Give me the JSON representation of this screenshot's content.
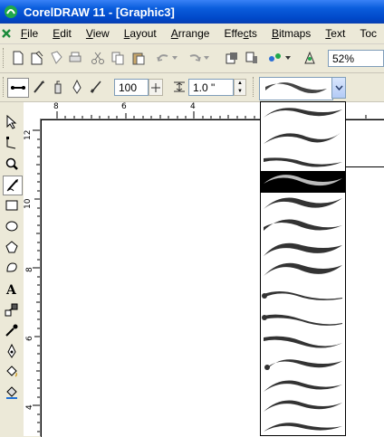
{
  "window": {
    "title": "CorelDRAW 11 - [Graphic3]"
  },
  "menu": [
    {
      "label": "File",
      "key": "F",
      "rest": "ile"
    },
    {
      "label": "Edit",
      "key": "E",
      "rest": "dit"
    },
    {
      "label": "View",
      "key": "V",
      "rest": "iew"
    },
    {
      "label": "Layout",
      "key": "L",
      "rest": "ayout"
    },
    {
      "label": "Arrange",
      "key": "A",
      "rest": "rrange"
    },
    {
      "label": "Effects",
      "key": "C",
      "pre": "Effe",
      "rest": "ts"
    },
    {
      "label": "Bitmaps",
      "key": "B",
      "rest": "itmaps"
    },
    {
      "label": "Text",
      "key": "T",
      "rest": "ext"
    },
    {
      "label": "Toc",
      "key": "",
      "rest": "Toc"
    }
  ],
  "standard_toolbar": {
    "zoom_value": "52%"
  },
  "property_bar": {
    "smoothing_value": "100",
    "width_value": "1.0 \""
  },
  "rulers": {
    "top_ticks": [
      "8",
      "6",
      "4"
    ],
    "left_ticks": [
      "12",
      "10",
      "8",
      "6",
      "4"
    ]
  },
  "stroke_list": {
    "selected_index": 3,
    "count": 15
  }
}
